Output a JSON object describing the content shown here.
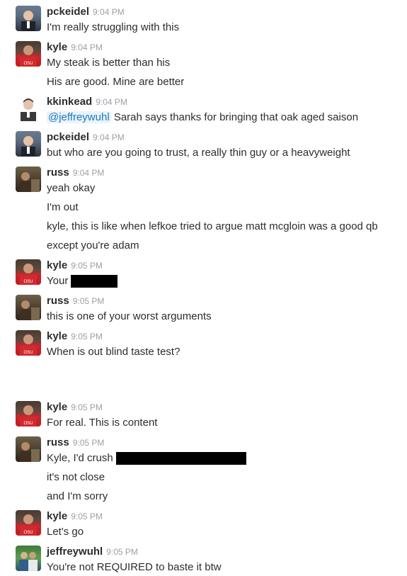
{
  "messages": [
    {
      "user": "pckeidel",
      "time": "9:04 PM",
      "avatar": "pckeidel-avatar",
      "lines": [
        "I'm really struggling with this"
      ]
    },
    {
      "user": "kyle",
      "time": "9:04 PM",
      "avatar": "kyle-avatar",
      "lines": [
        "My steak is better than his",
        "His are good. Mine are better"
      ]
    },
    {
      "user": "kkinkead",
      "time": "9:04 PM",
      "avatar": "kkinkead-avatar",
      "mention": "@jeffreywuhl",
      "lines": [
        "Sarah says thanks for bringing that oak aged saison"
      ]
    },
    {
      "user": "pckeidel",
      "time": "9:04 PM",
      "avatar": "pckeidel-avatar",
      "lines": [
        "but who are you going to trust, a really thin guy or a heavyweight"
      ]
    },
    {
      "user": "russ",
      "time": "9:04 PM",
      "avatar": "russ-avatar",
      "lines": [
        "yeah okay",
        "I'm out",
        "kyle, this is like when lefkoe tried to argue matt mcgloin was a good qb",
        "except you're adam"
      ]
    },
    {
      "user": "kyle",
      "time": "9:05 PM",
      "avatar": "kyle-avatar",
      "lines": [
        "Your"
      ]
    },
    {
      "user": "russ",
      "time": "9:05 PM",
      "avatar": "russ-avatar",
      "lines": [
        "this is one of your worst arguments"
      ]
    },
    {
      "user": "kyle",
      "time": "9:05 PM",
      "avatar": "kyle-avatar",
      "lines": [
        "When is out blind taste test?"
      ]
    },
    {
      "user": "kyle",
      "time": "9:05 PM",
      "avatar": "kyle-avatar",
      "lines": [
        "For real. This is content"
      ]
    },
    {
      "user": "russ",
      "time": "9:05 PM",
      "avatar": "russ-avatar",
      "lines": [
        "Kyle, I'd crush",
        "it's not close",
        "and I'm sorry"
      ]
    },
    {
      "user": "kyle",
      "time": "9:05 PM",
      "avatar": "kyle-avatar",
      "lines": [
        "Let's go"
      ]
    },
    {
      "user": "jeffreywuhl",
      "time": "9:05 PM",
      "avatar": "jeffreywuhl-avatar",
      "lines": [
        "You're not REQUIRED to baste it btw"
      ]
    }
  ]
}
